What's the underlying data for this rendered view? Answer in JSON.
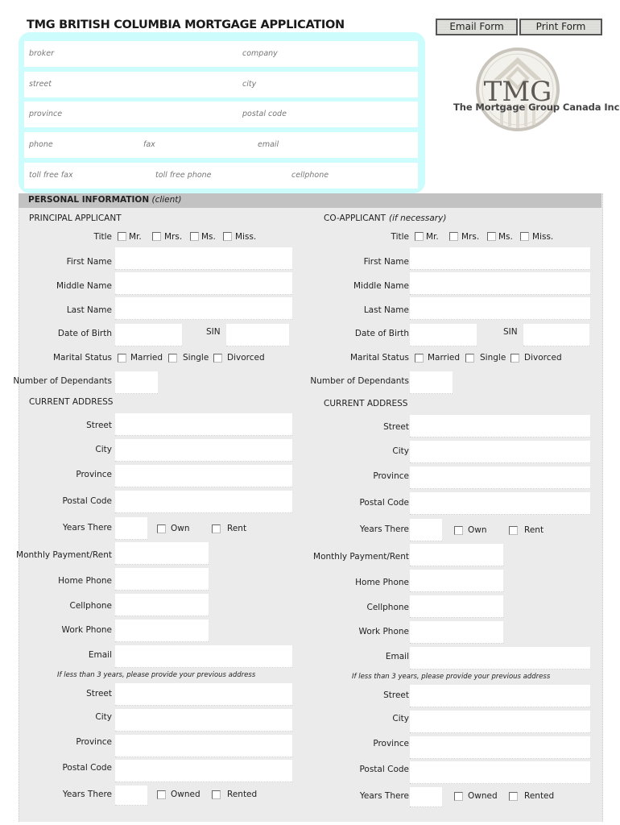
{
  "header": {
    "title": "TMG BRITISH COLUMBIA MORTGAGE APPLICATION",
    "email_button": "Email Form",
    "print_button": "Print Form"
  },
  "logo": {
    "mark": "TMG",
    "company": "The Mortgage Group Canada Inc.",
    "color": "#6b665e"
  },
  "broker_fields": {
    "broker": "broker",
    "company": "company",
    "street": "street",
    "city": "city",
    "province": "province",
    "postal_code": "postal code",
    "phone": "phone",
    "fax": "fax",
    "email": "email",
    "toll_free_fax": "toll free fax",
    "toll_free_phone": "toll free phone",
    "cellphone": "cellphone"
  },
  "personal": {
    "heading": "PERSONAL INFORMATION",
    "heading_suffix": "(client)"
  },
  "applicants": [
    {
      "heading": "PRINCIPAL APPLICANT",
      "heading_suffix": "",
      "title_label": "Title",
      "title_options": [
        "Mr.",
        "Mrs.",
        "Ms.",
        "Miss."
      ],
      "first_name": "First Name",
      "middle_name": "Middle Name",
      "last_name": "Last Name",
      "dob": "Date of Birth",
      "sin": "SIN",
      "marital_label": "Marital Status",
      "marital_options": [
        "Married",
        "Single",
        "Divorced"
      ],
      "dependants": "Number of  Dependants",
      "current_address": "CURRENT ADDRESS",
      "street": "Street",
      "city": "City",
      "province": "Province",
      "postal_code": "Postal Code",
      "years_there": "Years There",
      "own": "Own",
      "rent": "Rent",
      "monthly_payment": "Monthly Payment/Rent",
      "home_phone": "Home Phone",
      "cellphone": "Cellphone",
      "work_phone": "Work Phone",
      "email": "Email",
      "previous_note": "If less than 3 years, please provide your previous address",
      "prev_street": "Street",
      "prev_city": "City",
      "prev_province": "Province",
      "prev_postal_code": "Postal Code",
      "prev_years_there": "Years There",
      "owned": "Owned",
      "rented": "Rented"
    },
    {
      "heading": "CO-APPLICANT",
      "heading_suffix": "(if necessary)",
      "title_label": "Title",
      "title_options": [
        "Mr.",
        "Mrs.",
        "Ms.",
        "Miss."
      ],
      "first_name": "First Name",
      "middle_name": "Middle Name",
      "last_name": "Last Name",
      "dob": "Date of Birth",
      "sin": "SIN",
      "marital_label": "Marital Status",
      "marital_options": [
        "Married",
        "Single",
        "Divorced"
      ],
      "dependants": "Number of  Dependants",
      "current_address": "CURRENT ADDRESS",
      "street": "Street",
      "city": "City",
      "province": "Province",
      "postal_code": "Postal Code",
      "years_there": "Years There",
      "own": "Own",
      "rent": "Rent",
      "monthly_payment": "Monthly Payment/Rent",
      "home_phone": "Home Phone",
      "cellphone": "Cellphone",
      "work_phone": "Work Phone",
      "email": "Email",
      "previous_note": "If less than 3 years, please provide your previous address",
      "prev_street": "Street",
      "prev_city": "City",
      "prev_province": "Province",
      "prev_postal_code": "Postal Code",
      "prev_years_there": "Years There",
      "owned": "Owned",
      "rented": "Rented"
    }
  ]
}
